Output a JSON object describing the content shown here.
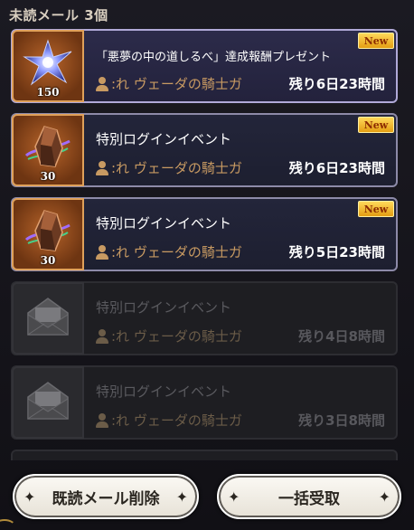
{
  "header": {
    "title": "未読メール 3個"
  },
  "mails": [
    {
      "title": "「悪夢の中の道しるべ」達成報酬プレゼント",
      "sender": ":れ ヴェーダの騎士ガ",
      "remaining": "残り6日23時間",
      "badge": "New",
      "quantity": "150",
      "icon": "star-crystal-icon",
      "status": "unread"
    },
    {
      "title": "特別ログインイベント",
      "sender": ":れ ヴェーダの騎士ガ",
      "remaining": "残り6日23時間",
      "badge": "New",
      "quantity": "30",
      "icon": "ore-crystal-icon",
      "status": "unread"
    },
    {
      "title": "特別ログインイベント",
      "sender": ":れ ヴェーダの騎士ガ",
      "remaining": "残り5日23時間",
      "badge": "New",
      "quantity": "30",
      "icon": "ore-crystal-icon",
      "status": "unread"
    },
    {
      "title": "特別ログインイベント",
      "sender": ":れ ヴェーダの騎士ガ",
      "remaining": "残り4日8時間",
      "icon": "opened-envelope-icon",
      "status": "read"
    },
    {
      "title": "特別ログインイベント",
      "sender": ":れ ヴェーダの騎士ガ",
      "remaining": "残り3日8時間",
      "icon": "opened-envelope-icon",
      "status": "read"
    }
  ],
  "buttons": {
    "delete_read": "既読メール削除",
    "receive_all": "一括受取"
  },
  "colors": {
    "badge": "#f0b020",
    "sender": "#c89a62",
    "item_frame": "#b7642a"
  }
}
